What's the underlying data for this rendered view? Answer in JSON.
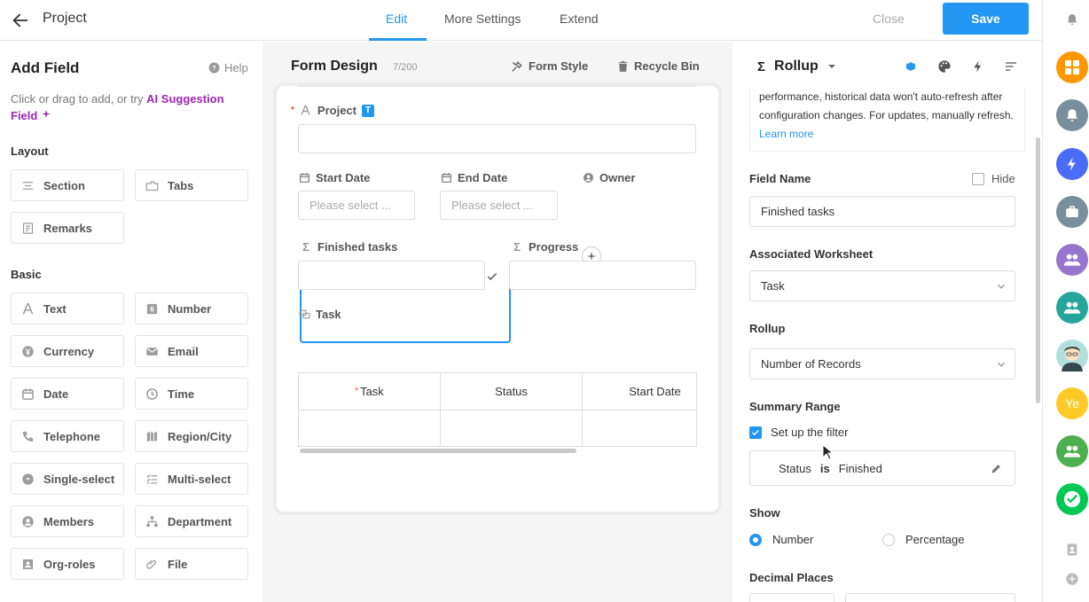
{
  "header": {
    "title": "Project",
    "tabs": [
      "Edit",
      "More Settings",
      "Extend"
    ],
    "close_label": "Close",
    "save_label": "Save"
  },
  "left_panel": {
    "title": "Add Field",
    "help_label": "Help",
    "hint_prefix": "Click or drag to add, or try ",
    "hint_ai": "AI Suggestion Field",
    "layout_label": "Layout",
    "layout_items": [
      {
        "label": "Section",
        "icon": "section-icon"
      },
      {
        "label": "Tabs",
        "icon": "tabs-icon"
      },
      {
        "label": "Remarks",
        "icon": "remarks-icon"
      }
    ],
    "basic_label": "Basic",
    "basic_items": [
      {
        "label": "Text",
        "icon": "text-icon"
      },
      {
        "label": "Number",
        "icon": "number-icon"
      },
      {
        "label": "Currency",
        "icon": "currency-icon"
      },
      {
        "label": "Email",
        "icon": "email-icon"
      },
      {
        "label": "Date",
        "icon": "date-icon"
      },
      {
        "label": "Time",
        "icon": "time-icon"
      },
      {
        "label": "Telephone",
        "icon": "telephone-icon"
      },
      {
        "label": "Region/City",
        "icon": "region-icon"
      },
      {
        "label": "Single-select",
        "icon": "single-select-icon"
      },
      {
        "label": "Multi-select",
        "icon": "multi-select-icon"
      },
      {
        "label": "Members",
        "icon": "members-icon"
      },
      {
        "label": "Department",
        "icon": "department-icon"
      },
      {
        "label": "Org-roles",
        "icon": "org-roles-icon"
      },
      {
        "label": "File",
        "icon": "file-icon"
      }
    ]
  },
  "canvas": {
    "title": "Form Design",
    "count": "7/200",
    "form_style_label": "Form Style",
    "recycle_bin_label": "Recycle Bin",
    "fields": {
      "project": {
        "label": "Project",
        "badge": "T"
      },
      "start_date": {
        "label": "Start Date",
        "placeholder": "Please select ..."
      },
      "end_date": {
        "label": "End Date",
        "placeholder": "Please select ..."
      },
      "owner": {
        "label": "Owner"
      },
      "finished_tasks": {
        "label": "Finished tasks"
      },
      "progress": {
        "label": "Progress"
      },
      "task": {
        "label": "Task"
      }
    },
    "subtable_columns": [
      "Task",
      "Status",
      "Start Date"
    ]
  },
  "right_panel": {
    "title": "Rollup",
    "notice_text": "performance, historical data won't auto-refresh after configuration changes. For updates, manually refresh.",
    "learn_more": "Learn more",
    "field_name_label": "Field Name",
    "hide_label": "Hide",
    "field_name_value": "Finished tasks",
    "worksheet_label": "Associated Worksheet",
    "worksheet_value": "Task",
    "rollup_label": "Rollup",
    "rollup_value": "Number of Records",
    "summary_label": "Summary Range",
    "filter_label": "Set up the filter",
    "filter_field": "Status",
    "filter_op": "is",
    "filter_value": "Finished",
    "show_label": "Show",
    "show_options": [
      "Number",
      "Percentage"
    ],
    "show_selected": "Number",
    "decimal_label": "Decimal Places"
  },
  "rail": {
    "avatar_text": "Ye",
    "colors": [
      "#ff9800",
      "#78909c",
      "#4a6cf7",
      "#78909c",
      "#9575cd",
      "#26a69a",
      "#ffca28",
      "#4caf50",
      "#00c853"
    ]
  }
}
